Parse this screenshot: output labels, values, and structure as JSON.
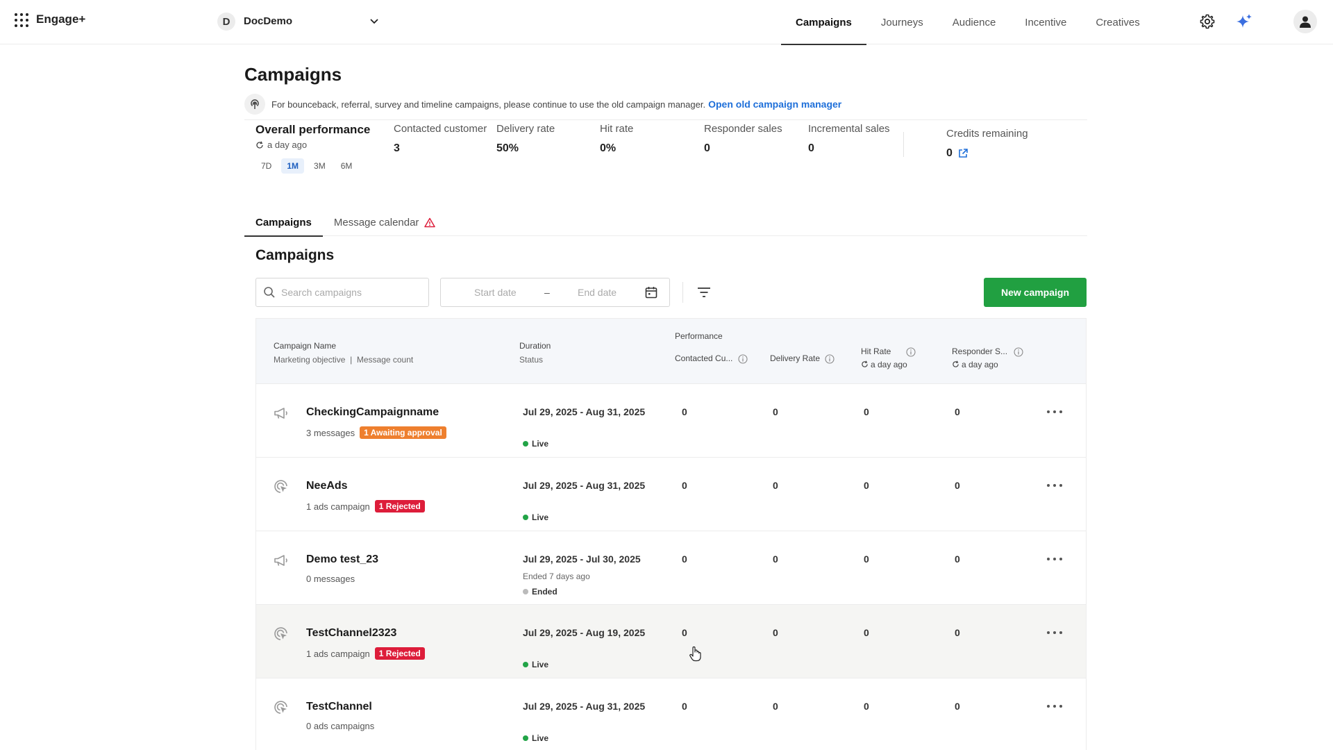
{
  "header": {
    "brand": "Engage+",
    "workspace_initial": "D",
    "workspace_name": "DocDemo",
    "nav": [
      "Campaigns",
      "Journeys",
      "Audience",
      "Incentive",
      "Creatives"
    ],
    "nav_active": "Campaigns"
  },
  "page": {
    "title": "Campaigns",
    "notice_text": "For bounceback, referral, survey and timeline campaigns, please continue to use the old campaign manager.",
    "notice_link": "Open old campaign manager"
  },
  "performance": {
    "title": "Overall performance",
    "updated": "a day ago",
    "ranges": [
      "7D",
      "1M",
      "3M",
      "6M"
    ],
    "range_active": "1M",
    "metrics": [
      {
        "label": "Contacted customer",
        "value": "3"
      },
      {
        "label": "Delivery rate",
        "value": "50%"
      },
      {
        "label": "Hit rate",
        "value": "0%"
      },
      {
        "label": "Responder sales",
        "value": "0"
      },
      {
        "label": "Incremental sales",
        "value": "0"
      }
    ],
    "credits_label": "Credits remaining",
    "credits_value": "0"
  },
  "tabs": {
    "campaigns": "Campaigns",
    "calendar": "Message calendar"
  },
  "list": {
    "title": "Campaigns",
    "search_placeholder": "Search campaigns",
    "start_placeholder": "Start date",
    "date_sep": "–",
    "end_placeholder": "End date",
    "new_button": "New campaign"
  },
  "table": {
    "col_name": "Campaign Name",
    "col_name_sub1": "Marketing objective",
    "col_name_sep": "|",
    "col_name_sub2": "Message count",
    "col_duration": "Duration",
    "col_status": "Status",
    "col_performance": "Performance",
    "col_contacted": "Contacted Cu...",
    "col_delivery": "Delivery Rate",
    "col_hit": "Hit Rate",
    "col_hit_updated": "a day ago",
    "col_responder": "Responder S...",
    "col_responder_updated": "a day ago",
    "rows": [
      {
        "icon": "megaphone-icon",
        "name": "CheckingCampaignname",
        "meta": "3 messages",
        "badge": "1 Awaiting approval",
        "badge_color": "#ee7f2e",
        "duration": "Jul 29, 2025 - Aug 31, 2025",
        "ended_note": "",
        "status": "Live",
        "contacted": "0",
        "delivery": "0",
        "hit": "0",
        "responder": "0"
      },
      {
        "icon": "ads-target-icon",
        "name": "NeeAds",
        "meta": "1 ads campaign",
        "badge": "1 Rejected",
        "badge_color": "#dd1d3a",
        "duration": "Jul 29, 2025 - Aug 31, 2025",
        "ended_note": "",
        "status": "Live",
        "contacted": "0",
        "delivery": "0",
        "hit": "0",
        "responder": "0"
      },
      {
        "icon": "megaphone-icon",
        "name": "Demo test_23",
        "meta": "0 messages",
        "badge": "",
        "badge_color": "",
        "duration": "Jul 29, 2025 - Jul 30, 2025",
        "ended_note": "Ended 7 days ago",
        "status": "Ended",
        "contacted": "0",
        "delivery": "0",
        "hit": "0",
        "responder": "0"
      },
      {
        "icon": "ads-target-icon",
        "name": "TestChannel2323",
        "meta": "1 ads campaign",
        "badge": "1 Rejected",
        "badge_color": "#dd1d3a",
        "duration": "Jul 29, 2025 - Aug 19, 2025",
        "ended_note": "",
        "status": "Live",
        "contacted": "0",
        "delivery": "0",
        "hit": "0",
        "responder": "0"
      },
      {
        "icon": "ads-target-icon",
        "name": "TestChannel",
        "meta": "0 ads campaigns",
        "badge": "",
        "badge_color": "",
        "duration": "Jul 29, 2025 - Aug 31, 2025",
        "ended_note": "",
        "status": "Live",
        "contacted": "0",
        "delivery": "0",
        "hit": "0",
        "responder": "0"
      }
    ]
  },
  "colors": {
    "accent_green": "#21a041",
    "link_blue": "#1e6fd9",
    "live_green": "#22a447",
    "ended_gray": "#bbb"
  }
}
